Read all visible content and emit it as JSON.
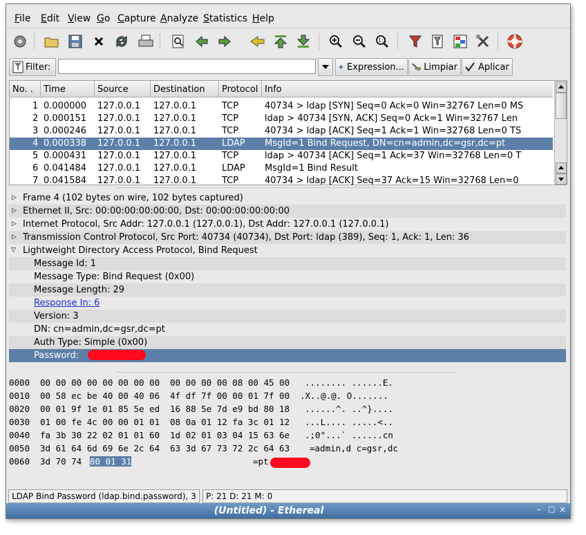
{
  "window": {
    "title": "(Untitled) - Ethereal"
  },
  "menubar": {
    "items": [
      {
        "u": "F",
        "rest": "ile"
      },
      {
        "u": "E",
        "rest": "dit"
      },
      {
        "u": "V",
        "rest": "iew"
      },
      {
        "u": "G",
        "rest": "o"
      },
      {
        "u": "C",
        "rest": "apture"
      },
      {
        "u": "A",
        "rest": "nalyze"
      },
      {
        "u": "S",
        "rest": "tatistics"
      },
      {
        "u": "H",
        "rest": "elp"
      }
    ]
  },
  "toolbar": {
    "icons": [
      "interfaces-icon",
      "open-icon",
      "save-icon",
      "close-icon",
      "reload-icon",
      "print-icon",
      "find-icon",
      "back-icon",
      "forward-icon",
      "goto-icon",
      "first-icon",
      "last-icon",
      "zoom-in-icon",
      "zoom-out-icon",
      "zoom-normal-icon",
      "capture-filter-icon",
      "display-filter-icon",
      "coloring-icon",
      "preferences-icon",
      "help-icon"
    ]
  },
  "filter": {
    "label": "Filter:",
    "value": "",
    "expression_label": "Expression...",
    "clear_label": "Limpiar",
    "apply_label": "Aplicar"
  },
  "packet_list": {
    "columns": [
      "No. .",
      "Time",
      "Source",
      "Destination",
      "Protocol",
      "Info"
    ],
    "rows": [
      {
        "no": "1",
        "time": "0.000000",
        "src": "127.0.0.1",
        "dst": "127.0.0.1",
        "proto": "TCP",
        "info": "40734 > ldap [SYN] Seq=0 Ack=0 Win=32767 Len=0 MS"
      },
      {
        "no": "2",
        "time": "0.000151",
        "src": "127.0.0.1",
        "dst": "127.0.0.1",
        "proto": "TCP",
        "info": "ldap > 40734 [SYN, ACK] Seq=0 Ack=1 Win=32767 Len"
      },
      {
        "no": "3",
        "time": "0.000246",
        "src": "127.0.0.1",
        "dst": "127.0.0.1",
        "proto": "TCP",
        "info": "40734 > ldap [ACK] Seq=1 Ack=1 Win=32768 Len=0 TS"
      },
      {
        "no": "4",
        "time": "0.000338",
        "src": "127.0.0.1",
        "dst": "127.0.0.1",
        "proto": "LDAP",
        "info": "MsgId=1 Bind Request, DN=cn=admin,dc=gsr,dc=pt",
        "selected": true
      },
      {
        "no": "5",
        "time": "0.000431",
        "src": "127.0.0.1",
        "dst": "127.0.0.1",
        "proto": "TCP",
        "info": "ldap > 40734 [ACK] Seq=1 Ack=37 Win=32768 Len=0 T"
      },
      {
        "no": "6",
        "time": "0.041484",
        "src": "127.0.0.1",
        "dst": "127.0.0.1",
        "proto": "LDAP",
        "info": "MsgId=1 Bind Result"
      },
      {
        "no": "7",
        "time": "0.041584",
        "src": "127.0.0.1",
        "dst": "127.0.0.1",
        "proto": "TCP",
        "info": "40734 > ldap [ACK] Seq=37 Ack=15 Win=32768 Len=0"
      }
    ]
  },
  "details": {
    "tree": [
      {
        "text": "Frame 4 (102 bytes on wire, 102 bytes captured)",
        "expander": "collapsed"
      },
      {
        "text": "Ethernet II, Src: 00:00:00:00:00:00, Dst: 00:00:00:00:00:00",
        "expander": "collapsed"
      },
      {
        "text": "Internet Protocol, Src Addr: 127.0.0.1 (127.0.0.1), Dst Addr: 127.0.0.1 (127.0.0.1)",
        "expander": "collapsed"
      },
      {
        "text": "Transmission Control Protocol, Src Port: 40734 (40734), Dst Port: ldap (389), Seq: 1, Ack: 1, Len: 36",
        "expander": "collapsed"
      },
      {
        "text": "Lightweight Directory Access Protocol, Bind Request",
        "expander": "expanded"
      }
    ],
    "ldap_fields": [
      {
        "text": "Message Id: 1"
      },
      {
        "text": "Message Type: Bind Request (0x00)"
      },
      {
        "text": "Message Length: 29"
      },
      {
        "text": "Response In: 6",
        "link": true
      },
      {
        "text": "Version: 3"
      },
      {
        "text": "DN: cn=admin,dc=gsr,dc=pt"
      },
      {
        "text": "Auth Type: Simple (0x00)"
      },
      {
        "text": "Password:",
        "selected": true
      }
    ]
  },
  "hex_dump": {
    "rows": [
      {
        "offset": "0000",
        "bytes1": "00 00 00 00 00 00 00 00",
        "bytes2": "00 00 00 00 08 00 45 00",
        "ascii": "........ ......E."
      },
      {
        "offset": "0010",
        "bytes1": "00 58 ec be 40 00 40 06",
        "bytes2": "4f df 7f 00 00 01 7f 00",
        "ascii": ".X..@.@. O......."
      },
      {
        "offset": "0020",
        "bytes1": "00 01 9f 1e 01 85 5e ed",
        "bytes2": "16 88 5e 7d e9 bd 80 18",
        "ascii": "......^. ..^}...."
      },
      {
        "offset": "0030",
        "bytes1": "01 00 fe 4c 00 00 01 01",
        "bytes2": "08 0a 01 12 fa 3c 01 12",
        "ascii": "...L.... .....<.."
      },
      {
        "offset": "0040",
        "bytes1": "fa 3b 30 22 02 01 01 60",
        "bytes2": "1d 02 01 03 04 15 63 6e",
        "ascii": ".;0\"...` ......cn"
      },
      {
        "offset": "0050",
        "bytes1": "3d 61 64 6d 69 6e 2c 64",
        "bytes2": "63 3d 67 73 72 2c 64 63",
        "ascii": "=admin,d c=gsr,dc"
      },
      {
        "offset": "0060",
        "bytes1": "3d 70 74",
        "bytes1_hl": "80 01 31",
        "bytes2": "",
        "ascii": "=pt"
      }
    ]
  },
  "statusbar": {
    "field_info": "LDAP Bind Password (ldap.bind.password), 3",
    "packets": "P: 21 D: 21 M: 0"
  },
  "colors": {
    "selection": "#5b7fa8",
    "redaction": "#ff0a1e",
    "titlebar": "#3f6f9f"
  }
}
